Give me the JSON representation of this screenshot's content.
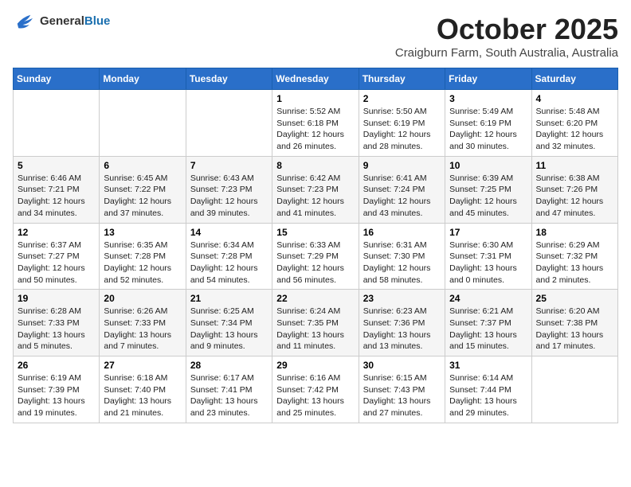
{
  "header": {
    "logo_general": "General",
    "logo_blue": "Blue",
    "month": "October 2025",
    "location": "Craigburn Farm, South Australia, Australia"
  },
  "days_of_week": [
    "Sunday",
    "Monday",
    "Tuesday",
    "Wednesday",
    "Thursday",
    "Friday",
    "Saturday"
  ],
  "weeks": [
    [
      {
        "day": "",
        "info": ""
      },
      {
        "day": "",
        "info": ""
      },
      {
        "day": "",
        "info": ""
      },
      {
        "day": "1",
        "info": "Sunrise: 5:52 AM\nSunset: 6:18 PM\nDaylight: 12 hours\nand 26 minutes."
      },
      {
        "day": "2",
        "info": "Sunrise: 5:50 AM\nSunset: 6:19 PM\nDaylight: 12 hours\nand 28 minutes."
      },
      {
        "day": "3",
        "info": "Sunrise: 5:49 AM\nSunset: 6:19 PM\nDaylight: 12 hours\nand 30 minutes."
      },
      {
        "day": "4",
        "info": "Sunrise: 5:48 AM\nSunset: 6:20 PM\nDaylight: 12 hours\nand 32 minutes."
      }
    ],
    [
      {
        "day": "5",
        "info": "Sunrise: 6:46 AM\nSunset: 7:21 PM\nDaylight: 12 hours\nand 34 minutes."
      },
      {
        "day": "6",
        "info": "Sunrise: 6:45 AM\nSunset: 7:22 PM\nDaylight: 12 hours\nand 37 minutes."
      },
      {
        "day": "7",
        "info": "Sunrise: 6:43 AM\nSunset: 7:23 PM\nDaylight: 12 hours\nand 39 minutes."
      },
      {
        "day": "8",
        "info": "Sunrise: 6:42 AM\nSunset: 7:23 PM\nDaylight: 12 hours\nand 41 minutes."
      },
      {
        "day": "9",
        "info": "Sunrise: 6:41 AM\nSunset: 7:24 PM\nDaylight: 12 hours\nand 43 minutes."
      },
      {
        "day": "10",
        "info": "Sunrise: 6:39 AM\nSunset: 7:25 PM\nDaylight: 12 hours\nand 45 minutes."
      },
      {
        "day": "11",
        "info": "Sunrise: 6:38 AM\nSunset: 7:26 PM\nDaylight: 12 hours\nand 47 minutes."
      }
    ],
    [
      {
        "day": "12",
        "info": "Sunrise: 6:37 AM\nSunset: 7:27 PM\nDaylight: 12 hours\nand 50 minutes."
      },
      {
        "day": "13",
        "info": "Sunrise: 6:35 AM\nSunset: 7:28 PM\nDaylight: 12 hours\nand 52 minutes."
      },
      {
        "day": "14",
        "info": "Sunrise: 6:34 AM\nSunset: 7:28 PM\nDaylight: 12 hours\nand 54 minutes."
      },
      {
        "day": "15",
        "info": "Sunrise: 6:33 AM\nSunset: 7:29 PM\nDaylight: 12 hours\nand 56 minutes."
      },
      {
        "day": "16",
        "info": "Sunrise: 6:31 AM\nSunset: 7:30 PM\nDaylight: 12 hours\nand 58 minutes."
      },
      {
        "day": "17",
        "info": "Sunrise: 6:30 AM\nSunset: 7:31 PM\nDaylight: 13 hours\nand 0 minutes."
      },
      {
        "day": "18",
        "info": "Sunrise: 6:29 AM\nSunset: 7:32 PM\nDaylight: 13 hours\nand 2 minutes."
      }
    ],
    [
      {
        "day": "19",
        "info": "Sunrise: 6:28 AM\nSunset: 7:33 PM\nDaylight: 13 hours\nand 5 minutes."
      },
      {
        "day": "20",
        "info": "Sunrise: 6:26 AM\nSunset: 7:33 PM\nDaylight: 13 hours\nand 7 minutes."
      },
      {
        "day": "21",
        "info": "Sunrise: 6:25 AM\nSunset: 7:34 PM\nDaylight: 13 hours\nand 9 minutes."
      },
      {
        "day": "22",
        "info": "Sunrise: 6:24 AM\nSunset: 7:35 PM\nDaylight: 13 hours\nand 11 minutes."
      },
      {
        "day": "23",
        "info": "Sunrise: 6:23 AM\nSunset: 7:36 PM\nDaylight: 13 hours\nand 13 minutes."
      },
      {
        "day": "24",
        "info": "Sunrise: 6:21 AM\nSunset: 7:37 PM\nDaylight: 13 hours\nand 15 minutes."
      },
      {
        "day": "25",
        "info": "Sunrise: 6:20 AM\nSunset: 7:38 PM\nDaylight: 13 hours\nand 17 minutes."
      }
    ],
    [
      {
        "day": "26",
        "info": "Sunrise: 6:19 AM\nSunset: 7:39 PM\nDaylight: 13 hours\nand 19 minutes."
      },
      {
        "day": "27",
        "info": "Sunrise: 6:18 AM\nSunset: 7:40 PM\nDaylight: 13 hours\nand 21 minutes."
      },
      {
        "day": "28",
        "info": "Sunrise: 6:17 AM\nSunset: 7:41 PM\nDaylight: 13 hours\nand 23 minutes."
      },
      {
        "day": "29",
        "info": "Sunrise: 6:16 AM\nSunset: 7:42 PM\nDaylight: 13 hours\nand 25 minutes."
      },
      {
        "day": "30",
        "info": "Sunrise: 6:15 AM\nSunset: 7:43 PM\nDaylight: 13 hours\nand 27 minutes."
      },
      {
        "day": "31",
        "info": "Sunrise: 6:14 AM\nSunset: 7:44 PM\nDaylight: 13 hours\nand 29 minutes."
      },
      {
        "day": "",
        "info": ""
      }
    ]
  ]
}
